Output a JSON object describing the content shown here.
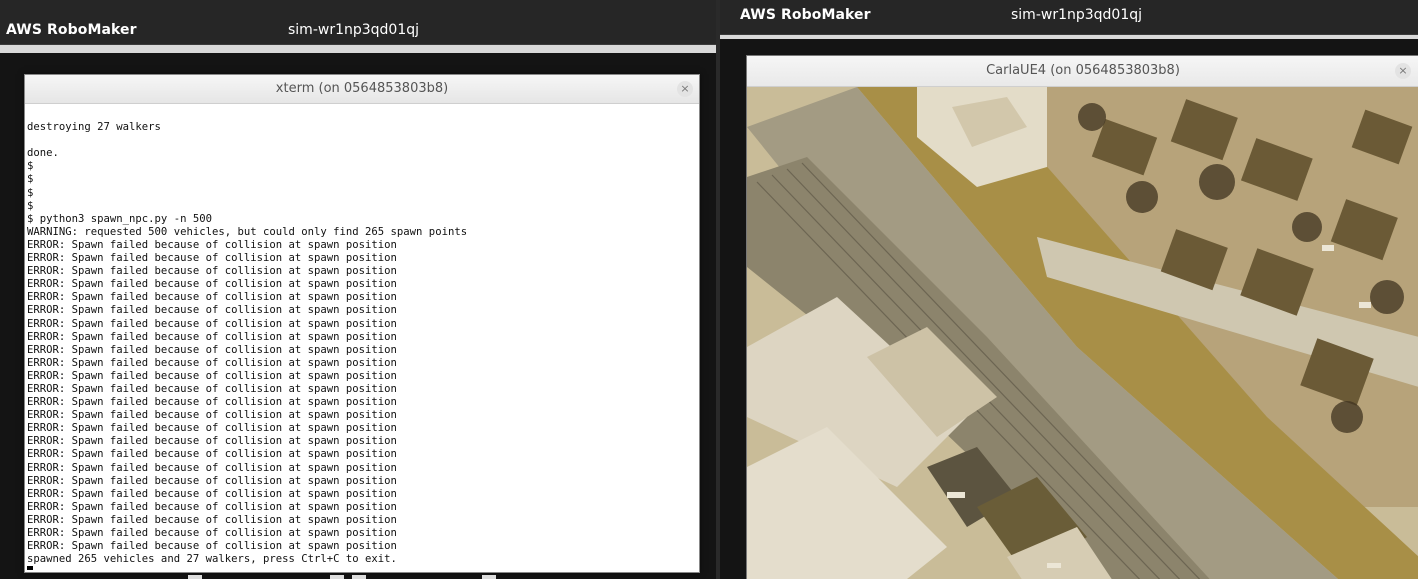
{
  "left_panel": {
    "app_title": "AWS RoboMaker",
    "sim_id": "sim-wr1np3qd01qj",
    "xterm": {
      "title": "xterm (on 0564853803b8)",
      "close_glyph": "×",
      "lines": [
        "",
        "destroying 27 walkers",
        "",
        "done.",
        "$",
        "$",
        "$",
        "$",
        "$ python3 spawn_npc.py -n 500",
        "WARNING: requested 500 vehicles, but could only find 265 spawn points",
        "ERROR: Spawn failed because of collision at spawn position",
        "ERROR: Spawn failed because of collision at spawn position",
        "ERROR: Spawn failed because of collision at spawn position",
        "ERROR: Spawn failed because of collision at spawn position",
        "ERROR: Spawn failed because of collision at spawn position",
        "ERROR: Spawn failed because of collision at spawn position",
        "ERROR: Spawn failed because of collision at spawn position",
        "ERROR: Spawn failed because of collision at spawn position",
        "ERROR: Spawn failed because of collision at spawn position",
        "ERROR: Spawn failed because of collision at spawn position",
        "ERROR: Spawn failed because of collision at spawn position",
        "ERROR: Spawn failed because of collision at spawn position",
        "ERROR: Spawn failed because of collision at spawn position",
        "ERROR: Spawn failed because of collision at spawn position",
        "ERROR: Spawn failed because of collision at spawn position",
        "ERROR: Spawn failed because of collision at spawn position",
        "ERROR: Spawn failed because of collision at spawn position",
        "ERROR: Spawn failed because of collision at spawn position",
        "ERROR: Spawn failed because of collision at spawn position",
        "ERROR: Spawn failed because of collision at spawn position",
        "ERROR: Spawn failed because of collision at spawn position",
        "ERROR: Spawn failed because of collision at spawn position",
        "ERROR: Spawn failed because of collision at spawn position",
        "ERROR: Spawn failed because of collision at spawn position",
        "spawned 265 vehicles and 27 walkers, press Ctrl+C to exit."
      ]
    }
  },
  "right_panel": {
    "app_title": "AWS RoboMaker",
    "sim_id": "sim-wr1np3qd01qj",
    "carla": {
      "title": "CarlaUE4   (on 0564853803b8)",
      "close_glyph": "×",
      "scene": "aerial city view"
    }
  },
  "colors": {
    "titlebar_bg": "#262626",
    "terminal_bg": "#ffffff",
    "terminal_fg": "#111111",
    "scene_tint": "#b9a56a"
  }
}
